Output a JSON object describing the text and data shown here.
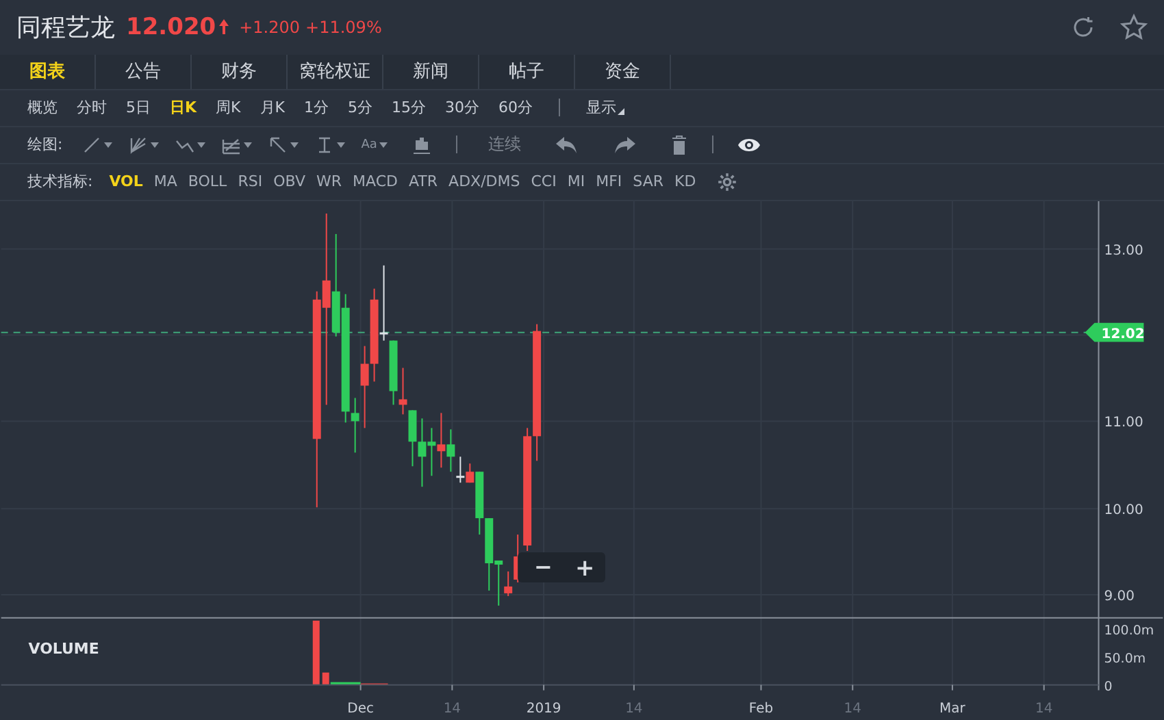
{
  "header": {
    "name": "同程艺龙",
    "price": "12.020",
    "change": "+1.200",
    "change_pct": "+11.09%"
  },
  "tabs": [
    {
      "label": "图表",
      "selected": true
    },
    {
      "label": "公告",
      "selected": false
    },
    {
      "label": "财务",
      "selected": false
    },
    {
      "label": "窝轮权证",
      "selected": false
    },
    {
      "label": "新闻",
      "selected": false
    },
    {
      "label": "帖子",
      "selected": false
    },
    {
      "label": "资金",
      "selected": false
    }
  ],
  "periods": [
    {
      "label": "概览",
      "selected": false
    },
    {
      "label": "分时",
      "selected": false
    },
    {
      "label": "5日",
      "selected": false
    },
    {
      "label": "日K",
      "selected": true
    },
    {
      "label": "周K",
      "selected": false
    },
    {
      "label": "月K",
      "selected": false
    },
    {
      "label": "1分",
      "selected": false
    },
    {
      "label": "5分",
      "selected": false
    },
    {
      "label": "15分",
      "selected": false
    },
    {
      "label": "30分",
      "selected": false
    },
    {
      "label": "60分",
      "selected": false
    }
  ],
  "display_menu": "显示",
  "drawing_toolbar": {
    "label": "绘图:",
    "tools": [
      {
        "kind": "line"
      },
      {
        "kind": "fan"
      },
      {
        "kind": "polyline"
      },
      {
        "kind": "grid"
      },
      {
        "kind": "arrow"
      },
      {
        "kind": "level"
      },
      {
        "kind": "text",
        "label": "Aa"
      }
    ],
    "continuous": "连续"
  },
  "indicators": {
    "label": "技术指标:",
    "items": [
      {
        "label": "VOL",
        "selected": true
      },
      {
        "label": "MA",
        "selected": false
      },
      {
        "label": "BOLL",
        "selected": false
      },
      {
        "label": "RSI",
        "selected": false
      },
      {
        "label": "OBV",
        "selected": false
      },
      {
        "label": "WR",
        "selected": false
      },
      {
        "label": "MACD",
        "selected": false
      },
      {
        "label": "ATR",
        "selected": false
      },
      {
        "label": "ADX/DMS",
        "selected": false
      },
      {
        "label": "CCI",
        "selected": false
      },
      {
        "label": "MI",
        "selected": false
      },
      {
        "label": "MFI",
        "selected": false
      },
      {
        "label": "SAR",
        "selected": false
      },
      {
        "label": "KD",
        "selected": false
      }
    ]
  },
  "chart": {
    "price_ticks": [
      "13.00",
      "11.00",
      "10.00",
      "9.00"
    ],
    "current_price": "12.02",
    "zoom_controls": [
      "−",
      "+"
    ],
    "volume_label": "VOLUME",
    "volume_ticks": [
      "100.0m",
      "50.0m",
      "0"
    ],
    "time_ticks": [
      {
        "label": "Dec",
        "kind": "major"
      },
      {
        "label": "14",
        "kind": "minor"
      },
      {
        "label": "2019",
        "kind": "major"
      },
      {
        "label": "14",
        "kind": "minor"
      },
      {
        "label": "Feb",
        "kind": "major"
      },
      {
        "label": "14",
        "kind": "minor"
      },
      {
        "label": "Mar",
        "kind": "major"
      },
      {
        "label": "14",
        "kind": "minor"
      }
    ]
  }
}
